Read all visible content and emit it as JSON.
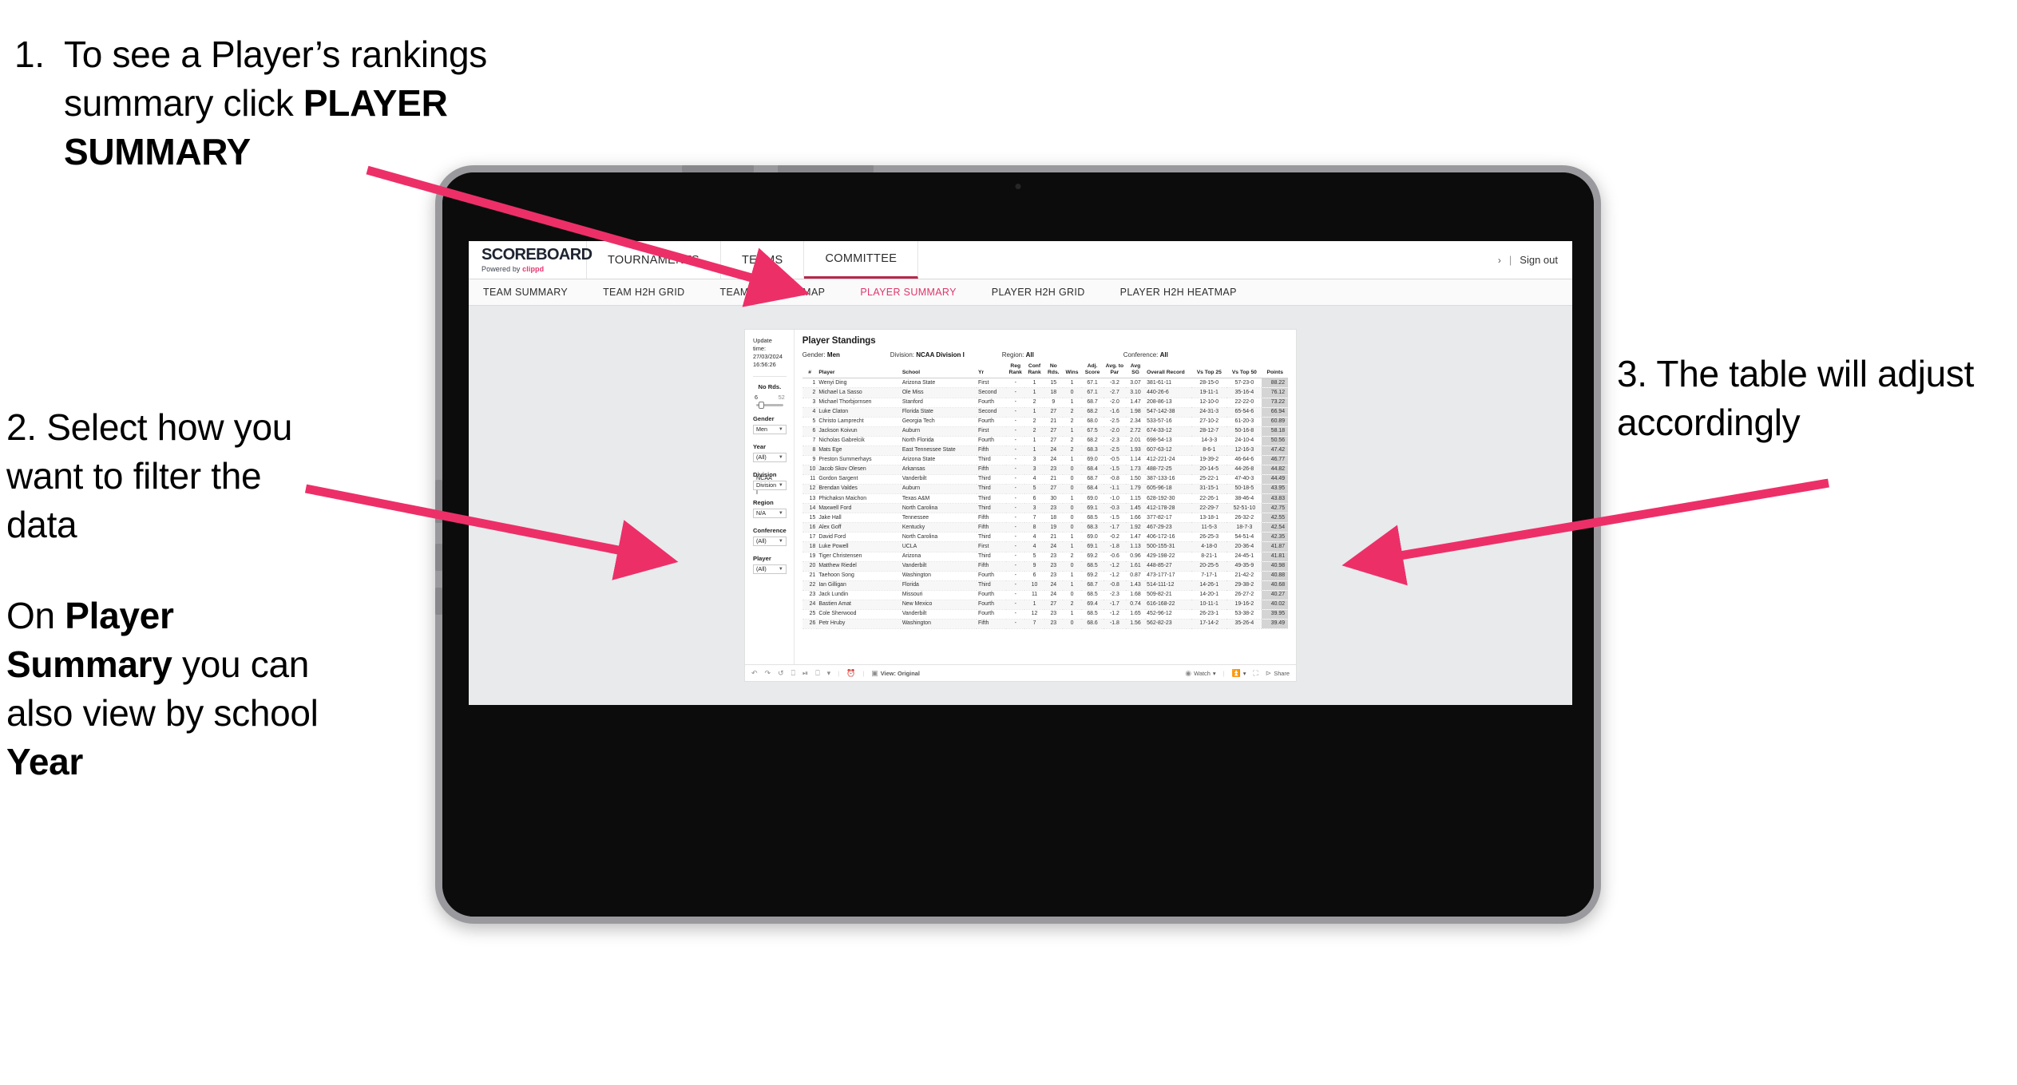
{
  "annotations": {
    "step1": {
      "num": "1.",
      "line1": "To see a Player’s rankings",
      "line2": "summary click ",
      "bold2": "PLAYER",
      "bold3": "SUMMARY"
    },
    "step2": {
      "p1": "2. Select how you want to filter the data",
      "p2_pre": "On ",
      "p2_b1": "Player Summary",
      "p2_mid": " you can also view by school ",
      "p2_b2": "Year"
    },
    "step3": {
      "text": "3. The table will adjust accordingly"
    }
  },
  "app": {
    "logo": {
      "main": "SCOREBOARD",
      "sub_pre": "Powered by ",
      "sub_brand": "clippd"
    },
    "top_nav": [
      {
        "label": "TOURNAMENTS",
        "active": false
      },
      {
        "label": "TEAMS",
        "active": false
      },
      {
        "label": "COMMITTEE",
        "active": true
      }
    ],
    "account": {
      "chevron": "›",
      "divider": "|",
      "sign_out": "Sign out"
    },
    "sub_nav": [
      {
        "label": "TEAM SUMMARY",
        "active": false
      },
      {
        "label": "TEAM H2H GRID",
        "active": false
      },
      {
        "label": "TEAM H2H HEATMAP",
        "active": false
      },
      {
        "label": "PLAYER SUMMARY",
        "active": true
      },
      {
        "label": "PLAYER H2H GRID",
        "active": false
      },
      {
        "label": "PLAYER H2H HEATMAP",
        "active": false
      }
    ],
    "accent_pink": "#e0356b",
    "accent_dark_red": "#b8274c"
  },
  "filters": {
    "update_label": "Update time:",
    "update_value": "27/03/2024 16:56:26",
    "slider": {
      "label": "No Rds.",
      "min": "6",
      "max": "52",
      "value_pct": 8
    },
    "selects": [
      {
        "label": "Gender",
        "value": "Men"
      },
      {
        "label": "Year",
        "value": "(All)"
      },
      {
        "label": "Division",
        "value": "NCAA Division I"
      },
      {
        "label": "Region",
        "value": "N/A"
      },
      {
        "label": "Conference",
        "value": "(All)"
      },
      {
        "label": "Player",
        "value": "(All)"
      }
    ]
  },
  "report": {
    "title": "Player Standings",
    "summary": [
      {
        "label": "Gender:",
        "value": "Men"
      },
      {
        "label": "Division:",
        "value": "NCAA Division I"
      },
      {
        "label": "Region:",
        "value": "All"
      },
      {
        "label": "Conference:",
        "value": "All"
      }
    ],
    "columns": [
      "#",
      "Player",
      "School",
      "Yr",
      "Reg Rank",
      "Conf Rank",
      "No Rds.",
      "Wins",
      "Adj. Score",
      "Avg. to Par",
      "Avg SG",
      "Overall Record",
      "Vs Top 25",
      "Vs Top 50",
      "Points"
    ],
    "rows": [
      [
        "1",
        "Wenyi Ding",
        "Arizona State",
        "First",
        "-",
        "1",
        "15",
        "1",
        "67.1",
        "-3.2",
        "3.07",
        "381-61-11",
        "28-15-0",
        "57-23-0",
        "88.22"
      ],
      [
        "2",
        "Michael La Sasso",
        "Ole Miss",
        "Second",
        "-",
        "1",
        "18",
        "0",
        "67.1",
        "-2.7",
        "3.10",
        "440-26-6",
        "19-11-1",
        "35-16-4",
        "76.12"
      ],
      [
        "3",
        "Michael Thorbjornsen",
        "Stanford",
        "Fourth",
        "-",
        "2",
        "9",
        "1",
        "68.7",
        "-2.0",
        "1.47",
        "208-86-13",
        "12-10-0",
        "22-22-0",
        "73.22"
      ],
      [
        "4",
        "Luke Claton",
        "Florida State",
        "Second",
        "-",
        "1",
        "27",
        "2",
        "68.2",
        "-1.6",
        "1.98",
        "547-142-38",
        "24-31-3",
        "65-54-6",
        "66.94"
      ],
      [
        "5",
        "Christo Lamprecht",
        "Georgia Tech",
        "Fourth",
        "-",
        "2",
        "21",
        "2",
        "68.0",
        "-2.5",
        "2.34",
        "533-57-16",
        "27-10-2",
        "61-20-3",
        "60.89"
      ],
      [
        "6",
        "Jackson Koivun",
        "Auburn",
        "First",
        "-",
        "2",
        "27",
        "1",
        "67.5",
        "-2.0",
        "2.72",
        "674-33-12",
        "28-12-7",
        "50-16-8",
        "58.18"
      ],
      [
        "7",
        "Nicholas Gabrelcik",
        "North Florida",
        "Fourth",
        "-",
        "1",
        "27",
        "2",
        "68.2",
        "-2.3",
        "2.01",
        "698-54-13",
        "14-3-3",
        "24-10-4",
        "50.56"
      ],
      [
        "8",
        "Mats Ege",
        "East Tennessee State",
        "Fifth",
        "-",
        "1",
        "24",
        "2",
        "68.3",
        "-2.5",
        "1.93",
        "607-63-12",
        "8-6-1",
        "12-16-3",
        "47.42"
      ],
      [
        "9",
        "Preston Summerhays",
        "Arizona State",
        "Third",
        "-",
        "3",
        "24",
        "1",
        "69.0",
        "-0.5",
        "1.14",
        "412-221-24",
        "19-39-2",
        "46-64-6",
        "46.77"
      ],
      [
        "10",
        "Jacob Skov Olesen",
        "Arkansas",
        "Fifth",
        "-",
        "3",
        "23",
        "0",
        "68.4",
        "-1.5",
        "1.73",
        "488-72-25",
        "20-14-5",
        "44-26-8",
        "44.82"
      ],
      [
        "11",
        "Gordon Sargent",
        "Vanderbilt",
        "Third",
        "-",
        "4",
        "21",
        "0",
        "68.7",
        "-0.8",
        "1.50",
        "387-133-16",
        "25-22-1",
        "47-40-3",
        "44.49"
      ],
      [
        "12",
        "Brendan Valdes",
        "Auburn",
        "Third",
        "-",
        "5",
        "27",
        "0",
        "68.4",
        "-1.1",
        "1.79",
        "605-96-18",
        "31-15-1",
        "50-18-5",
        "43.95"
      ],
      [
        "13",
        "Phichaksn Maichon",
        "Texas A&M",
        "Third",
        "-",
        "6",
        "30",
        "1",
        "69.0",
        "-1.0",
        "1.15",
        "628-192-30",
        "22-26-1",
        "38-46-4",
        "43.83"
      ],
      [
        "14",
        "Maxwell Ford",
        "North Carolina",
        "Third",
        "-",
        "3",
        "23",
        "0",
        "69.1",
        "-0.3",
        "1.45",
        "412-178-28",
        "22-29-7",
        "52-51-10",
        "42.75"
      ],
      [
        "15",
        "Jake Hall",
        "Tennessee",
        "Fifth",
        "-",
        "7",
        "18",
        "0",
        "68.5",
        "-1.5",
        "1.66",
        "377-82-17",
        "13-18-1",
        "26-32-2",
        "42.55"
      ],
      [
        "16",
        "Alex Goff",
        "Kentucky",
        "Fifth",
        "-",
        "8",
        "19",
        "0",
        "68.3",
        "-1.7",
        "1.92",
        "467-29-23",
        "11-5-3",
        "18-7-3",
        "42.54"
      ],
      [
        "17",
        "David Ford",
        "North Carolina",
        "Third",
        "-",
        "4",
        "21",
        "1",
        "69.0",
        "-0.2",
        "1.47",
        "406-172-16",
        "26-25-3",
        "54-51-4",
        "42.35"
      ],
      [
        "18",
        "Luke Powell",
        "UCLA",
        "First",
        "-",
        "4",
        "24",
        "1",
        "69.1",
        "-1.8",
        "1.13",
        "500-155-31",
        "4-18-0",
        "20-36-4",
        "41.87"
      ],
      [
        "19",
        "Tiger Christensen",
        "Arizona",
        "Third",
        "-",
        "5",
        "23",
        "2",
        "69.2",
        "-0.6",
        "0.96",
        "429-198-22",
        "8-21-1",
        "24-45-1",
        "41.81"
      ],
      [
        "20",
        "Matthew Riedel",
        "Vanderbilt",
        "Fifth",
        "-",
        "9",
        "23",
        "0",
        "68.5",
        "-1.2",
        "1.61",
        "448-85-27",
        "20-25-5",
        "49-35-9",
        "40.98"
      ],
      [
        "21",
        "Taehoon Song",
        "Washington",
        "Fourth",
        "-",
        "6",
        "23",
        "1",
        "69.2",
        "-1.2",
        "0.87",
        "473-177-17",
        "7-17-1",
        "21-42-2",
        "40.88"
      ],
      [
        "22",
        "Ian Gilligan",
        "Florida",
        "Third",
        "-",
        "10",
        "24",
        "1",
        "68.7",
        "-0.8",
        "1.43",
        "514-111-12",
        "14-26-1",
        "29-38-2",
        "40.68"
      ],
      [
        "23",
        "Jack Lundin",
        "Missouri",
        "Fourth",
        "-",
        "11",
        "24",
        "0",
        "68.5",
        "-2.3",
        "1.68",
        "509-82-21",
        "14-20-1",
        "26-27-2",
        "40.27"
      ],
      [
        "24",
        "Bastien Amat",
        "New Mexico",
        "Fourth",
        "-",
        "1",
        "27",
        "2",
        "69.4",
        "-1.7",
        "0.74",
        "616-168-22",
        "10-11-1",
        "19-16-2",
        "40.02"
      ],
      [
        "25",
        "Cole Sherwood",
        "Vanderbilt",
        "Fourth",
        "-",
        "12",
        "23",
        "1",
        "68.5",
        "-1.2",
        "1.65",
        "452-96-12",
        "26-23-1",
        "53-38-2",
        "39.95"
      ],
      [
        "26",
        "Petr Hruby",
        "Washington",
        "Fifth",
        "-",
        "7",
        "23",
        "0",
        "68.6",
        "-1.8",
        "1.56",
        "562-82-23",
        "17-14-2",
        "35-26-4",
        "39.49"
      ]
    ]
  },
  "toolbar": {
    "undo": "undo-icon",
    "redo": "redo-icon",
    "revert": "revert-icon",
    "refresh": "refresh-icon",
    "pause": "pause-icon",
    "view_dropdown": "view-dropdown-icon",
    "custom_views_label": "View: Original",
    "watch_label": "Watch",
    "share_label": "Share"
  }
}
